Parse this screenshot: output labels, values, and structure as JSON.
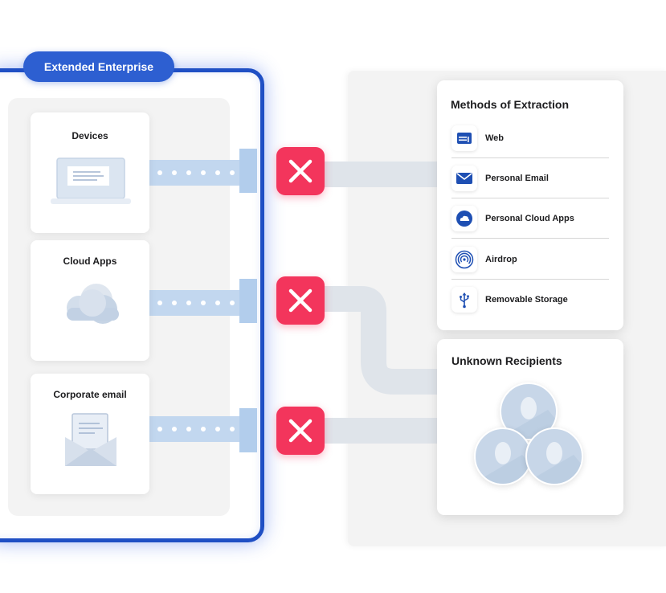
{
  "boundary": {
    "label": "Extended Enterprise"
  },
  "sources": [
    {
      "title": "Devices",
      "icon": "laptop-icon"
    },
    {
      "title": "Cloud Apps",
      "icon": "cloud-icon"
    },
    {
      "title": "Corporate email",
      "icon": "envelope-icon"
    }
  ],
  "methods": {
    "title": "Methods of Extraction",
    "items": [
      {
        "label": "Web",
        "icon": "browser-window-icon"
      },
      {
        "label": "Personal Email",
        "icon": "mail-icon"
      },
      {
        "label": "Personal Cloud Apps",
        "icon": "cloud-icon"
      },
      {
        "label": "Airdrop",
        "icon": "airdrop-icon"
      },
      {
        "label": "Removable Storage",
        "icon": "usb-icon"
      }
    ]
  },
  "recipients": {
    "title": "Unknown Recipients",
    "icon": "user-avatar-icon"
  },
  "colors": {
    "boundary": "#1f4fc4",
    "pill": "#2d5fd1",
    "block": "#f3355c",
    "flow": "#c2d7ef",
    "icon_blue": "#1e4fb3"
  }
}
